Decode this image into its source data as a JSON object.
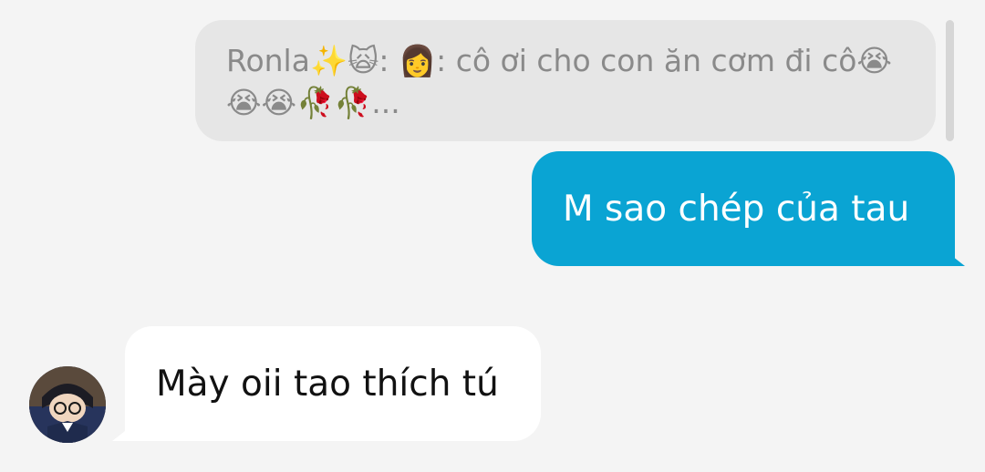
{
  "quoted_message": {
    "line1": "Ronla✨🙀: 👩: cô ơi cho con ăn cơm đi cô😭",
    "line2": "😭😭🥀🥀..."
  },
  "outgoing_message": {
    "text": "M sao chép của tau"
  },
  "incoming_message": {
    "text": "Mày oii tao thích tú"
  },
  "colors": {
    "background": "#f4f4f4",
    "quote_bubble": "#e6e6e6",
    "outgoing_bubble": "#0aa4d3",
    "incoming_bubble": "#ffffff"
  },
  "icons": {
    "avatar": "avatar-icon"
  }
}
